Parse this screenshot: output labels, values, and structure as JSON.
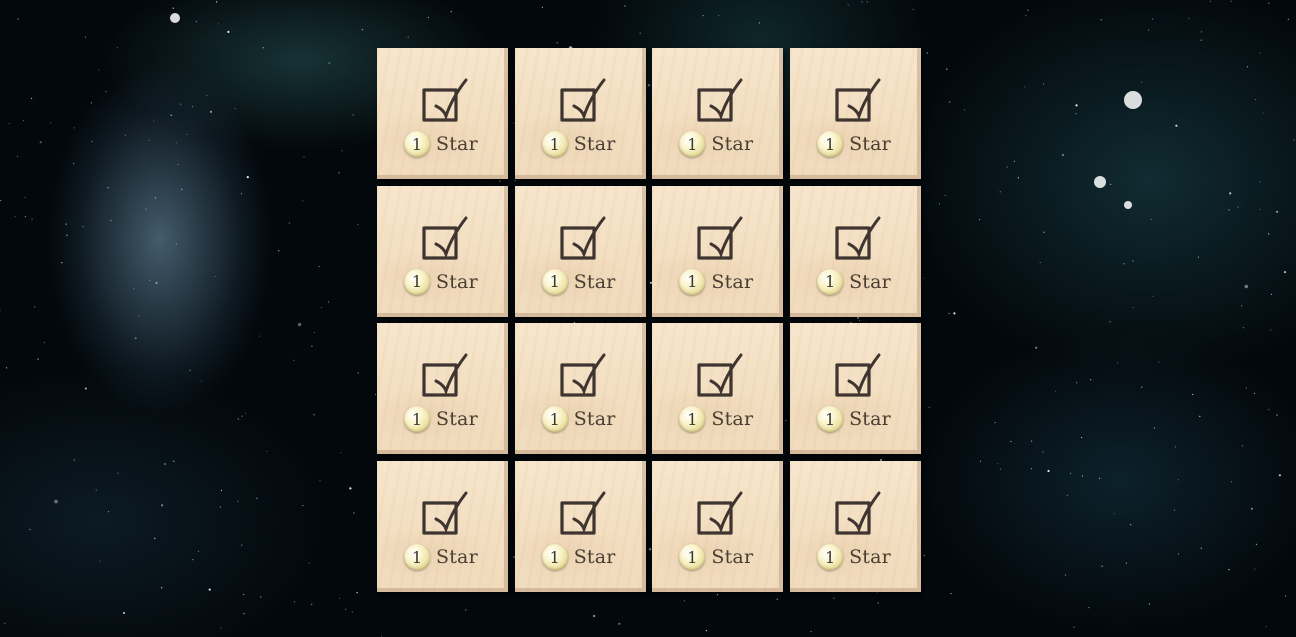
{
  "board": {
    "columns": 4,
    "rows": 4,
    "tiles": [
      {
        "star_count": "1",
        "star_label": "Star",
        "icon": "checkbox-icon"
      },
      {
        "star_count": "1",
        "star_label": "Star",
        "icon": "checkbox-icon"
      },
      {
        "star_count": "1",
        "star_label": "Star",
        "icon": "checkbox-icon"
      },
      {
        "star_count": "1",
        "star_label": "Star",
        "icon": "checkbox-icon"
      },
      {
        "star_count": "1",
        "star_label": "Star",
        "icon": "checkbox-icon"
      },
      {
        "star_count": "1",
        "star_label": "Star",
        "icon": "checkbox-icon"
      },
      {
        "star_count": "1",
        "star_label": "Star",
        "icon": "checkbox-icon"
      },
      {
        "star_count": "1",
        "star_label": "Star",
        "icon": "checkbox-icon"
      },
      {
        "star_count": "1",
        "star_label": "Star",
        "icon": "checkbox-icon"
      },
      {
        "star_count": "1",
        "star_label": "Star",
        "icon": "checkbox-icon"
      },
      {
        "star_count": "1",
        "star_label": "Star",
        "icon": "checkbox-icon"
      },
      {
        "star_count": "1",
        "star_label": "Star",
        "icon": "checkbox-icon"
      },
      {
        "star_count": "1",
        "star_label": "Star",
        "icon": "checkbox-icon"
      },
      {
        "star_count": "1",
        "star_label": "Star",
        "icon": "checkbox-icon"
      },
      {
        "star_count": "1",
        "star_label": "Star",
        "icon": "checkbox-icon"
      },
      {
        "star_count": "1",
        "star_label": "Star",
        "icon": "checkbox-icon"
      }
    ]
  },
  "colors": {
    "tile_wood": "#f3dfc2",
    "tile_text": "#4a3e33",
    "badge": "#f3eab8",
    "background": "#03080c"
  }
}
